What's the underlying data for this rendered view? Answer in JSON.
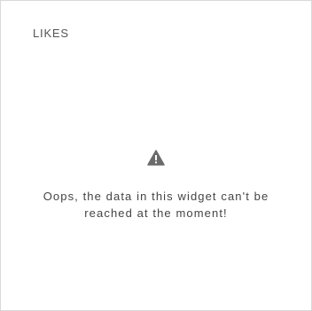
{
  "widget": {
    "title": "LIKES",
    "icon": "warning-icon",
    "message_line1": "Oops, the data in this widget can't be",
    "message_line2": "reached at the moment!"
  },
  "colors": {
    "border": "#d9d9d9",
    "title_text": "#555555",
    "message_text": "#444444",
    "icon": "#6b6b6b"
  }
}
